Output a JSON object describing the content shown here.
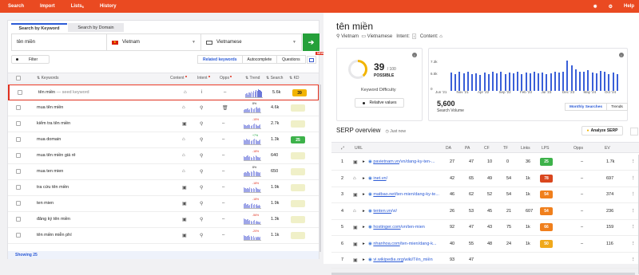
{
  "topbar": {
    "nav": [
      "Search",
      "Import",
      "Lists",
      "History"
    ],
    "lists_badge": "6",
    "right_icons": [
      "star-icon",
      "gear-icon"
    ],
    "help": "Help",
    "color": "#ea4a21"
  },
  "left": {
    "tabs": [
      "Search by Keyword",
      "Search by Domain"
    ],
    "keyword_value": "tên miền",
    "location": "Vietnam",
    "language": "Vietnamese",
    "filter_label": "Filter",
    "subtabs": [
      "Related keywords",
      "Autocomplete",
      "Questions"
    ],
    "new_badge": "NEW",
    "columns": {
      "keywords": "Keywords",
      "content": "Content",
      "intent": "Intent",
      "opps": "Opps",
      "trend": "Trend",
      "search": "Search",
      "kd": "KD"
    },
    "rows": [
      {
        "kw": "tên miền",
        "seed": "— seed keyword",
        "content": "⌂",
        "intent": "i",
        "opps": "–",
        "pct": "",
        "search": "5.6k",
        "kd": "39",
        "kd_color": "#f2b400",
        "kd_text": "#222"
      },
      {
        "kw": "mua tên miền",
        "seed": "",
        "content": "⌂",
        "intent": "⚲",
        "opps": "🗑",
        "pct": "8%",
        "search": "4.6k",
        "kd": "",
        "kd_color": "#f0f0c8",
        "kd_text": "#222"
      },
      {
        "kw": "kiểm tra tên miền",
        "seed": "",
        "content": "▣",
        "intent": "⚲",
        "opps": "–",
        "pct": "-15%",
        "search": "2.7k",
        "kd": "",
        "kd_color": "#f0f0c8",
        "kd_text": "#222"
      },
      {
        "kw": "mua domain",
        "seed": "",
        "content": "⌂",
        "intent": "⚲",
        "opps": "–",
        "pct": "+7%",
        "search": "1.3k",
        "kd": "25",
        "kd_color": "#3db24a",
        "kd_text": "#fff"
      },
      {
        "kw": "mua tên miền giá rẻ",
        "seed": "",
        "content": "⌂",
        "intent": "⚲",
        "opps": "–",
        "pct": "-18%",
        "search": "640",
        "kd": "",
        "kd_color": "#f0f0c8",
        "kd_text": "#222"
      },
      {
        "kw": "mua ten mien",
        "seed": "",
        "content": "⌂",
        "intent": "⚲",
        "opps": "–",
        "pct": "8%",
        "search": "650",
        "kd": "",
        "kd_color": "#f0f0c8",
        "kd_text": "#222"
      },
      {
        "kw": "tra cứu tên miền",
        "seed": "",
        "content": "▣",
        "intent": "⚲",
        "opps": "–",
        "pct": "-18%",
        "search": "1.9k",
        "kd": "",
        "kd_color": "#f0f0c8",
        "kd_text": "#222"
      },
      {
        "kw": "ten mien",
        "seed": "",
        "content": "▣",
        "intent": "⚲",
        "opps": "–",
        "pct": "-18%",
        "search": "1.9k",
        "kd": "",
        "kd_color": "#f0f0c8",
        "kd_text": "#222"
      },
      {
        "kw": "đăng ký tên miền",
        "seed": "",
        "content": "▣",
        "intent": "⚲",
        "opps": "–",
        "pct": "-56%",
        "search": "1.3k",
        "kd": "",
        "kd_color": "#f0f0c8",
        "kd_text": "#222"
      },
      {
        "kw": "tên miền miễn phí",
        "seed": "",
        "content": "▣",
        "intent": "⚲",
        "opps": "–",
        "pct": "-20%",
        "search": "1.1k",
        "kd": "",
        "kd_color": "#f0f0c8",
        "kd_text": "#222"
      }
    ],
    "showing": "Showing 25"
  },
  "right": {
    "title": "tên miền",
    "location": "Vietnam",
    "language": "Vietnamese",
    "intent_label": "Intent:",
    "intent_value": "i",
    "content_label": "Content:",
    "kd": {
      "value": "39",
      "max": "/ 100",
      "label": "POSSIBLE",
      "caption": "Keyword Difficulty",
      "related_btn": "Relative values",
      "fraction": 0.39
    },
    "volume": {
      "total": "5,600",
      "caption": "Search Volume",
      "y_ticks": [
        "7.3k",
        "6.5k",
        "0"
      ],
      "x_ticks": [
        "Jun '21",
        "Nov '21",
        "Apr '22",
        "Sep '22",
        "Feb '23",
        "Jul '23",
        "Dec '23",
        "May '24",
        "Oct '24"
      ],
      "tabs": [
        "Monthly Searches",
        "Trends"
      ]
    },
    "serp": {
      "title": "SERP overview",
      "updated": "Just now",
      "analyze_btn": "Analyze SERP",
      "columns": [
        "URL",
        "DA",
        "PA",
        "CF",
        "TF",
        "Links",
        "LPS",
        "Opps",
        "EV"
      ],
      "rows": [
        {
          "n": "1",
          "type": "▣",
          "domain": "pavietnam.vn",
          "path": "/vn/dang-ky-ten-...",
          "da": "27",
          "pa": "47",
          "cf": "10",
          "tf": "0",
          "links": "36",
          "lps": "25",
          "lps_color": "#3db24a",
          "opps": "–",
          "ev": "1.7k"
        },
        {
          "n": "2",
          "type": "⌂",
          "domain": "inet.vn",
          "path": "/",
          "da": "42",
          "pa": "65",
          "cf": "49",
          "tf": "54",
          "links": "1k",
          "lps": "78",
          "lps_color": "#d9461e",
          "opps": "–",
          "ev": "697"
        },
        {
          "n": "3",
          "type": "▣",
          "domain": "matbao.net",
          "path": "/ten-mien/dang-ky-te...",
          "da": "46",
          "pa": "62",
          "cf": "52",
          "tf": "54",
          "links": "1k",
          "lps": "54",
          "lps_color": "#f07f1c",
          "opps": "–",
          "ev": "374"
        },
        {
          "n": "4",
          "type": "⌂",
          "domain": "tenten.vn",
          "path": "/vi/",
          "da": "26",
          "pa": "53",
          "cf": "45",
          "tf": "21",
          "links": "607",
          "lps": "54",
          "lps_color": "#f07f1c",
          "opps": "–",
          "ev": "236"
        },
        {
          "n": "5",
          "type": "▣",
          "domain": "hostinger.com",
          "path": "/vn/ten-mien",
          "da": "92",
          "pa": "47",
          "cf": "43",
          "tf": "75",
          "links": "1k",
          "lps": "66",
          "lps_color": "#f07f1c",
          "opps": "–",
          "ev": "159"
        },
        {
          "n": "6",
          "type": "▣",
          "domain": "nhanhoa.com",
          "path": "/ten-mien/dang-k...",
          "da": "40",
          "pa": "55",
          "cf": "48",
          "tf": "24",
          "links": "1k",
          "lps": "50",
          "lps_color": "#f0a91c",
          "opps": "–",
          "ev": "116"
        },
        {
          "n": "7",
          "type": "▣",
          "domain": "vi.wikipedia.org",
          "path": "/wiki/Tên_miền",
          "da": "93",
          "pa": "47",
          "cf": "",
          "tf": "",
          "links": "",
          "lps": "",
          "lps_color": "#f0a91c",
          "opps": "",
          "ev": ""
        }
      ]
    }
  }
}
